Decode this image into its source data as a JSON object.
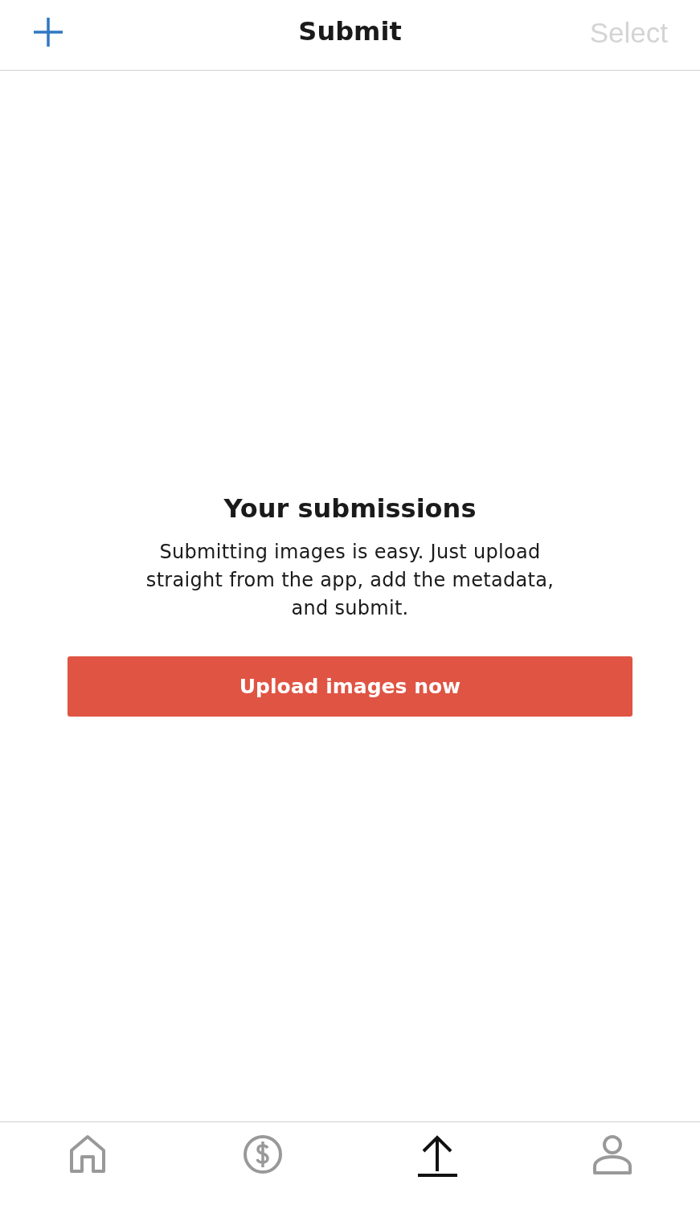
{
  "header": {
    "title": "Submit",
    "add_button": {
      "disabled": false
    },
    "select_button": {
      "label": "Select",
      "disabled": true
    }
  },
  "empty_state": {
    "title": "Your submissions",
    "text": "Submitting images is easy. Just upload straight from the app, add the metadata, and submit.",
    "button": "Upload images now"
  },
  "tab_bar": [
    {
      "kind": "home",
      "selected": false
    },
    {
      "kind": "money",
      "selected": false
    },
    {
      "kind": "upload",
      "selected": true
    },
    {
      "kind": "profile",
      "selected": false
    }
  ]
}
